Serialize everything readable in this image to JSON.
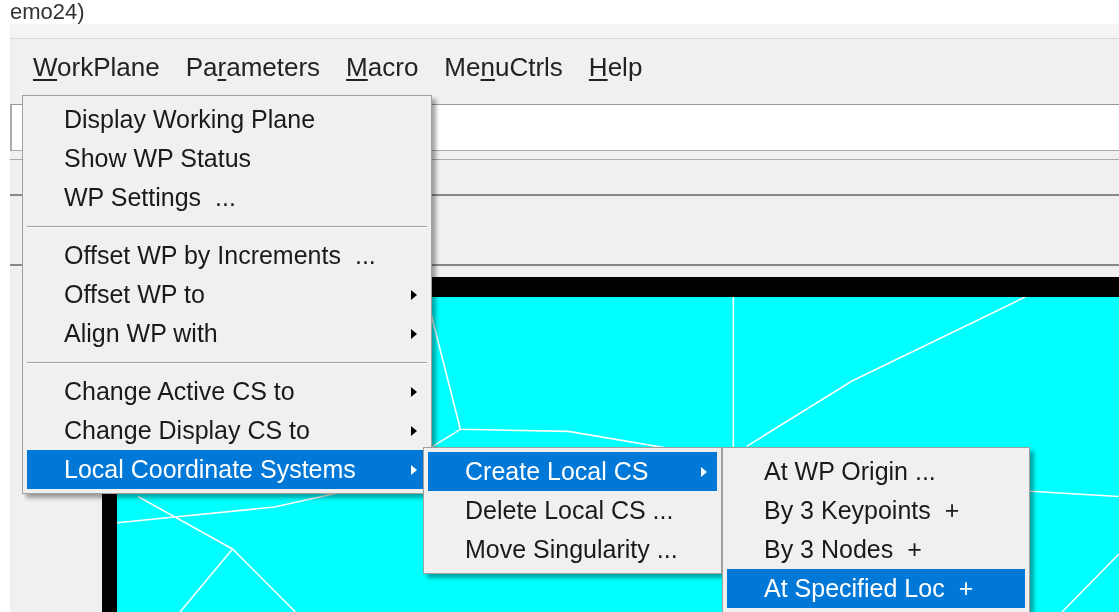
{
  "window": {
    "title": "emo24)"
  },
  "menubar": [
    {
      "key": "W",
      "post": "orkPlane"
    },
    {
      "pre": "Pa",
      "key": "r",
      "post": "ameters"
    },
    {
      "key": "M",
      "post": "acro"
    },
    {
      "pre": "Me",
      "key": "n",
      "post": "uCtrls"
    },
    {
      "key": "H",
      "post": "elp"
    }
  ],
  "menus": [
    {
      "items": [
        {
          "kind": "item",
          "label": "Display Working Plane",
          "selected": false
        },
        {
          "kind": "item",
          "label": "Show WP Status",
          "selected": false
        },
        {
          "kind": "item",
          "label": "WP Settings",
          "suffix": "...",
          "selected": false
        },
        {
          "kind": "separator"
        },
        {
          "kind": "item",
          "label": "Offset WP by Increments",
          "suffix": "...",
          "selected": false
        },
        {
          "kind": "item",
          "label": "Offset WP to",
          "submenu": true,
          "selected": false
        },
        {
          "kind": "item",
          "label": "Align WP with",
          "submenu": true,
          "selected": false
        },
        {
          "kind": "separator"
        },
        {
          "kind": "item",
          "label": "Change Active CS to",
          "submenu": true,
          "selected": false
        },
        {
          "kind": "item",
          "label": "Change Display CS to",
          "submenu": true,
          "selected": false
        },
        {
          "kind": "item",
          "label": "Local Coordinate Systems",
          "submenu": true,
          "selected": true
        }
      ]
    },
    {
      "items": [
        {
          "kind": "item",
          "label": "Create Local CS",
          "submenu": true,
          "selected": true
        },
        {
          "kind": "item",
          "label": "Delete Local CS ...",
          "selected": false
        },
        {
          "kind": "item",
          "label": "Move Singularity ...",
          "selected": false
        }
      ]
    },
    {
      "items": [
        {
          "kind": "item",
          "label": "At WP Origin ...",
          "selected": false
        },
        {
          "kind": "item",
          "label": "By 3 Keypoints",
          "suffix": "+",
          "selected": false
        },
        {
          "kind": "item",
          "label": "By 3 Nodes",
          "suffix": "+",
          "selected": false
        },
        {
          "kind": "item",
          "label": "At Specified Loc",
          "suffix": "+",
          "selected": true
        }
      ]
    }
  ]
}
